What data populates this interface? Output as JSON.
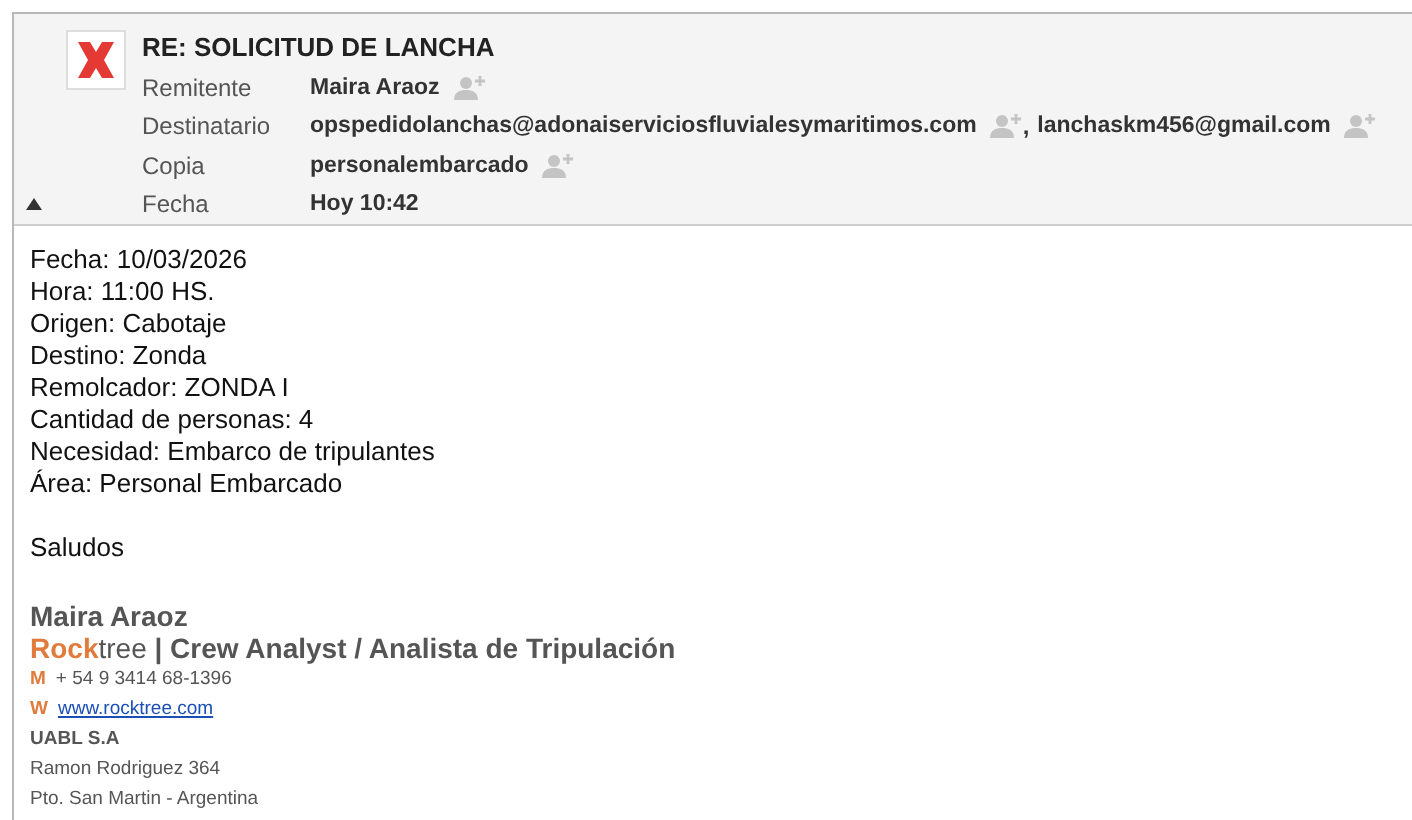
{
  "header": {
    "subject": "RE: SOLICITUD DE LANCHA",
    "fields": [
      {
        "label": "Remitente",
        "values": [
          "Maira Araoz"
        ]
      },
      {
        "label": "Destinatario",
        "values": [
          "opspedidolanchas@adonaiserviciosfluvialesymaritimos.com",
          "lanchaskm456@gmail.com"
        ],
        "separator": ","
      },
      {
        "label": "Copia",
        "values": [
          "personalembarcado"
        ]
      },
      {
        "label": "Fecha",
        "values": [
          "Hoy 10:42"
        ],
        "kind": "date"
      }
    ],
    "expanded": true
  },
  "body": {
    "lines": [
      "Fecha: 10/03/2026",
      "Hora: 11:00 HS.",
      "Origen: Cabotaje",
      "Destino: Zonda",
      "Remolcador: ZONDA I",
      "Cantidad de personas: 4",
      "Necesidad: Embarco de tripulantes",
      "Área: Personal Embarcado"
    ],
    "closing": "Saludos"
  },
  "signature": {
    "name": "Maira Araoz",
    "brand_accent": "Rock",
    "brand_rest": "tree",
    "title": "| Crew  Analyst / Analista de Tripulación",
    "contacts": [
      {
        "key": "M",
        "value": "+ 54 9 3414 68-1396",
        "kind": "phone"
      },
      {
        "key": "W",
        "value": "www.rocktree.com",
        "kind": "link"
      }
    ],
    "company": "UABL S.A",
    "address": [
      "Ramon Rodriguez 364",
      "Pto. San Martin - Argentina"
    ]
  }
}
